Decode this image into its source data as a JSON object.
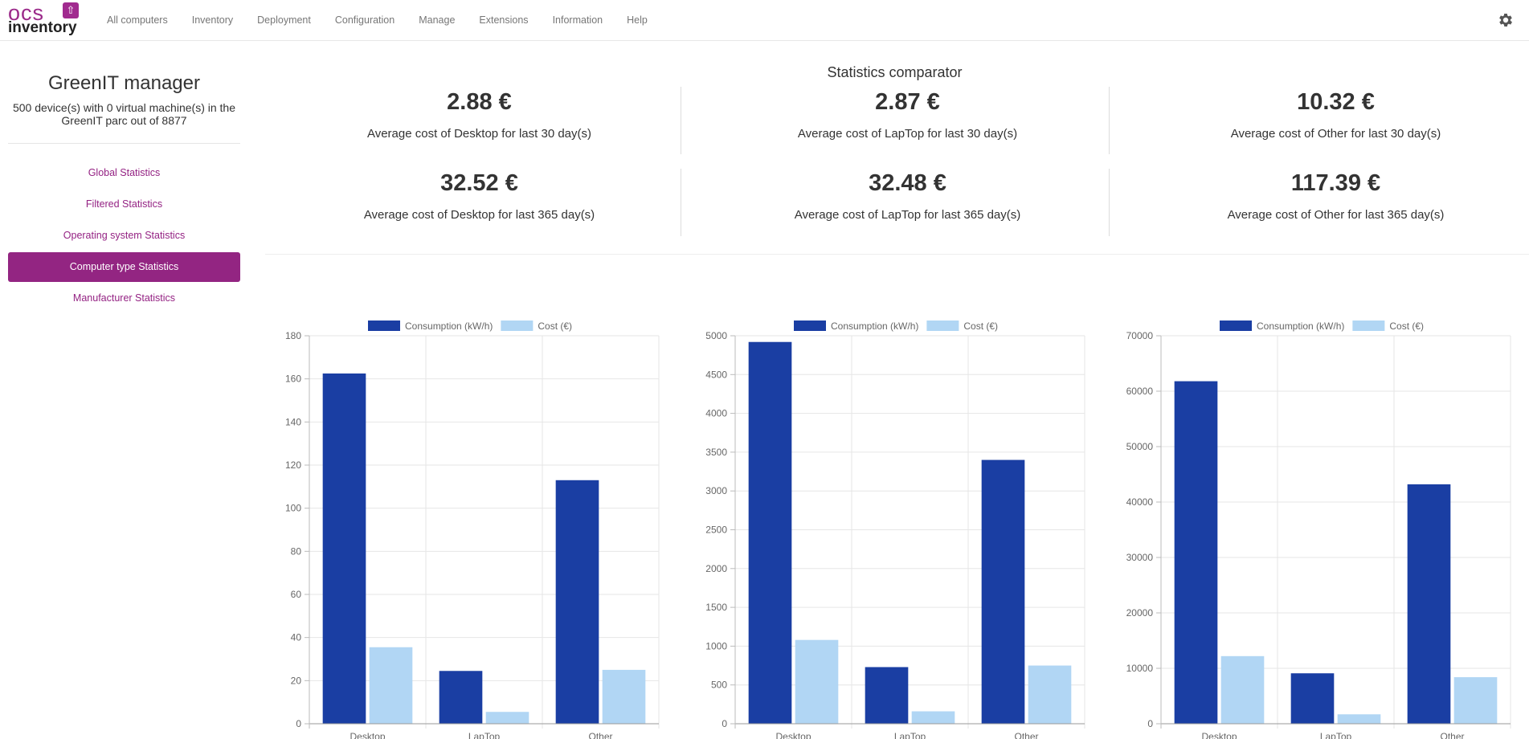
{
  "brand": {
    "logo_top": "ocs",
    "logo_bottom": "inventory",
    "logo_icon": "upload-arrow-icon"
  },
  "nav": {
    "items": [
      "All computers",
      "Inventory",
      "Deployment",
      "Configuration",
      "Manage",
      "Extensions",
      "Information",
      "Help"
    ],
    "settings_icon": "gear-icon"
  },
  "sidebar": {
    "title": "GreenIT manager",
    "subtitle": "500 device(s) with 0 virtual machine(s) in the GreenIT parc out of 8877",
    "menu": [
      {
        "label": "Global Statistics",
        "active": false
      },
      {
        "label": "Filtered Statistics",
        "active": false
      },
      {
        "label": "Operating system Statistics",
        "active": false
      },
      {
        "label": "Computer type Statistics",
        "active": true
      },
      {
        "label": "Manufacturer Statistics",
        "active": false
      }
    ]
  },
  "comparator": {
    "title": "Statistics comparator",
    "stats": [
      {
        "value": "2.88 €",
        "label": "Average cost of Desktop for last 30 day(s)"
      },
      {
        "value": "2.87 €",
        "label": "Average cost of LapTop for last 30 day(s)"
      },
      {
        "value": "10.32 €",
        "label": "Average cost of Other for last 30 day(s)"
      },
      {
        "value": "32.52 €",
        "label": "Average cost of Desktop for last 365 day(s)"
      },
      {
        "value": "32.48 €",
        "label": "Average cost of LapTop for last 365 day(s)"
      },
      {
        "value": "117.39 €",
        "label": "Average cost of Other for last 365 day(s)"
      }
    ]
  },
  "colors": {
    "accent": "#932582",
    "consumption": "#1a3ea3",
    "cost": "#b1d6f4"
  },
  "chart_data": [
    {
      "type": "bar",
      "categories": [
        "Desktop",
        "LapTop",
        "Other"
      ],
      "series": [
        {
          "name": "Consumption (kW/h)",
          "values": [
            162.5,
            24.5,
            113
          ]
        },
        {
          "name": "Cost (€)",
          "values": [
            35.5,
            5.5,
            25
          ]
        }
      ],
      "ylim": [
        0,
        180
      ],
      "yticks": [
        0,
        20,
        40,
        60,
        80,
        100,
        120,
        140,
        160,
        180
      ],
      "legend": "top"
    },
    {
      "type": "bar",
      "categories": [
        "Desktop",
        "LapTop",
        "Other"
      ],
      "series": [
        {
          "name": "Consumption (kW/h)",
          "values": [
            4920,
            730,
            3400
          ]
        },
        {
          "name": "Cost (€)",
          "values": [
            1080,
            160,
            750
          ]
        }
      ],
      "ylim": [
        0,
        5000
      ],
      "yticks": [
        0,
        500,
        1000,
        1500,
        2000,
        2500,
        3000,
        3500,
        4000,
        4500,
        5000
      ],
      "legend": "top"
    },
    {
      "type": "bar",
      "categories": [
        "Desktop",
        "LapTop",
        "Other"
      ],
      "series": [
        {
          "name": "Consumption (kW/h)",
          "values": [
            61800,
            9100,
            43200
          ]
        },
        {
          "name": "Cost (€)",
          "values": [
            12200,
            1700,
            8400
          ]
        }
      ],
      "ylim": [
        0,
        70000
      ],
      "yticks": [
        0,
        10000,
        20000,
        30000,
        40000,
        50000,
        60000,
        70000
      ],
      "legend": "top"
    }
  ]
}
